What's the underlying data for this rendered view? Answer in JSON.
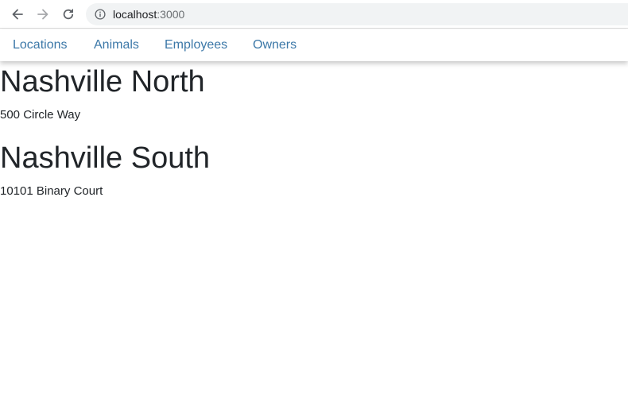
{
  "browser": {
    "url_host": "localhost",
    "url_port": ":3000",
    "icons": {
      "back": "arrow-left-icon",
      "forward": "arrow-right-icon",
      "reload": "reload-icon",
      "site_info": "info-icon"
    }
  },
  "nav": {
    "items": [
      {
        "label": "Locations"
      },
      {
        "label": "Animals"
      },
      {
        "label": "Employees"
      },
      {
        "label": "Owners"
      }
    ],
    "link_color": "#3c78a8"
  },
  "locations": [
    {
      "name": "Nashville North",
      "address": "500 Circle Way"
    },
    {
      "name": "Nashville South",
      "address": "10101 Binary Court"
    }
  ]
}
